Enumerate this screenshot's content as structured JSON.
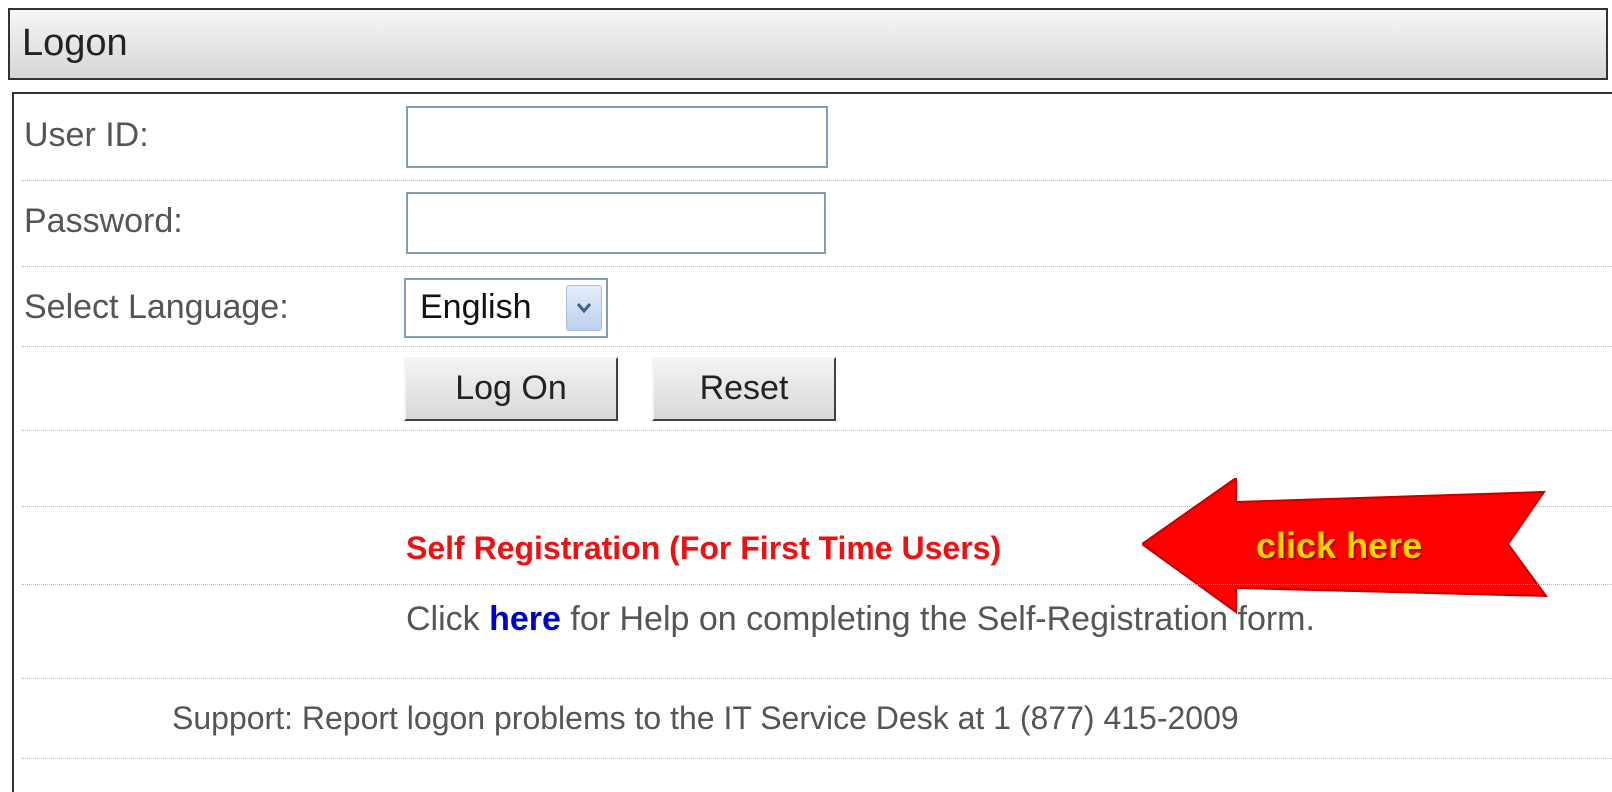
{
  "header": {
    "title": "Logon"
  },
  "form": {
    "userid_label": "User ID:",
    "userid_value": "",
    "password_label": "Password:",
    "password_value": "",
    "language_label": "Select Language:",
    "language_selected": "English",
    "logon_button": "Log On",
    "reset_button": "Reset"
  },
  "self_registration": {
    "link_text": "Self Registration (For First Time Users)",
    "callout_text": "click here",
    "callout_color": "#ff0000",
    "callout_text_color": "#ffd400"
  },
  "help": {
    "prefix": "Click ",
    "link_text": "here",
    "suffix": " for Help on completing the Self-Registration form."
  },
  "support": {
    "text": "Support: Report logon problems to the IT Service Desk at 1 (877) 415-2009"
  },
  "colors": {
    "link": "#0000cc",
    "selfreg": "#ee1111",
    "input_border": "#7f9db9"
  }
}
